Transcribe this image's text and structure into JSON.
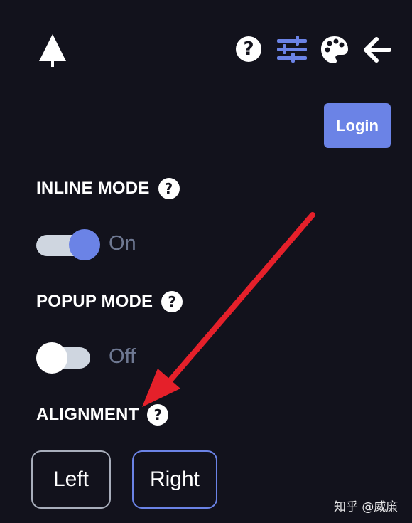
{
  "header": {
    "icons": [
      "tree-logo",
      "help-icon",
      "sliders-icon",
      "palette-icon",
      "back-arrow-icon"
    ],
    "help_glyph": "?"
  },
  "login": {
    "label": "Login"
  },
  "inline_mode": {
    "title": "INLINE MODE",
    "state_label": "On",
    "enabled": true
  },
  "popup_mode": {
    "title": "POPUP MODE",
    "state_label": "Off",
    "enabled": false
  },
  "alignment": {
    "title": "ALIGNMENT",
    "options": [
      "Left",
      "Right"
    ],
    "selected": "Right"
  },
  "colors": {
    "background": "#12121c",
    "accent": "#6b83e6",
    "arrow": "#e5202a"
  },
  "watermark": {
    "text": "知乎 @威廉"
  }
}
